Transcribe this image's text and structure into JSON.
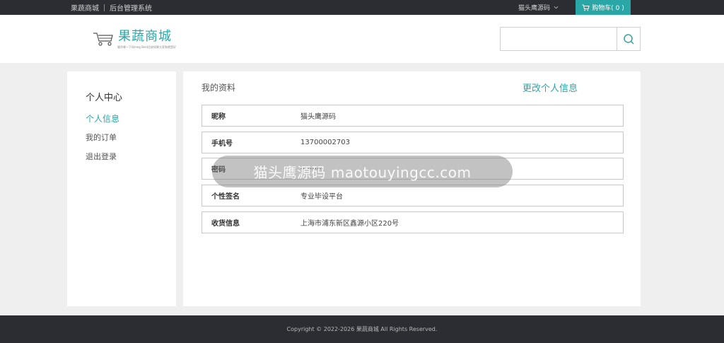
{
  "topbar": {
    "site_name": "果蔬商城",
    "admin_link": "后台管理系统",
    "username": "猫头鹰源码",
    "cart_label": "购物车( 0 )"
  },
  "header": {
    "logo_title": "果蔬商城",
    "logo_subtitle": "猫华果一下如meg Best比较如果大家和就是好",
    "search_placeholder": ""
  },
  "sidebar": {
    "title": "个人中心",
    "items": [
      {
        "label": "个人信息",
        "active": true
      },
      {
        "label": "我的订单",
        "active": false
      },
      {
        "label": "退出登录",
        "active": false
      }
    ]
  },
  "profile": {
    "heading": "我的资料",
    "edit_label": "更改个人信息",
    "fields": [
      {
        "label": "昵称",
        "value": "猫头鹰源码"
      },
      {
        "label": "手机号",
        "value": "13700002703"
      },
      {
        "label": "密码",
        "value": "••••••••••"
      },
      {
        "label": "个性签名",
        "value": "专业毕设平台"
      },
      {
        "label": "收货信息",
        "value": "上海市浦东新区鑫源小区220号"
      }
    ]
  },
  "overlay": {
    "watermark_text": "猫头鹰源码 maotouyingcc.com"
  },
  "footer": {
    "copyright": "Copyright © 2022-2026 果蔬商城 All Rights Reserved."
  },
  "colors": {
    "accent": "#2aa6a6",
    "dark_bar": "#2b2d33",
    "page_bg": "#efefef"
  }
}
